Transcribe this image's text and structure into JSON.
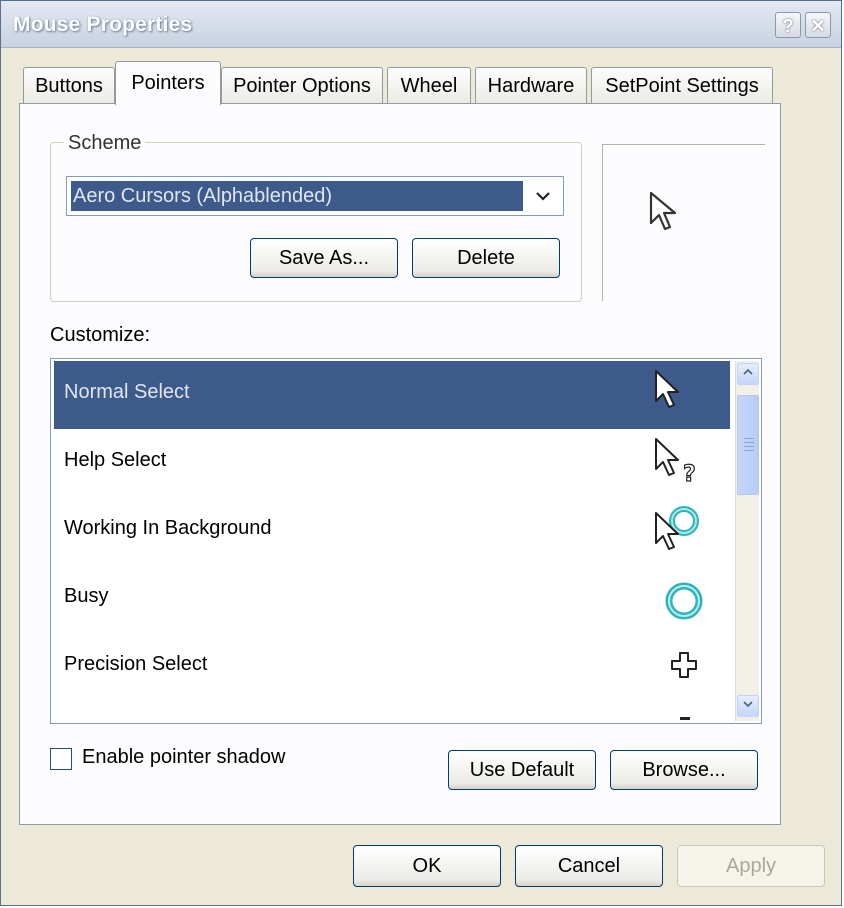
{
  "window": {
    "title": "Mouse Properties",
    "help_glyph": "?",
    "close_glyph": "✕"
  },
  "tabs": [
    "Buttons",
    "Pointers",
    "Pointer Options",
    "Wheel",
    "Hardware",
    "SetPoint Settings"
  ],
  "active_tab": "Pointers",
  "scheme": {
    "label": "Scheme",
    "selected": "Aero Cursors (Alphablended)",
    "dropdown_glyph": "⌄",
    "save_as": "Save As...",
    "delete": "Delete"
  },
  "customize": {
    "label": "Customize:",
    "items": [
      {
        "label": "Normal Select",
        "icon": "arrow-cursor-icon",
        "selected": true
      },
      {
        "label": "Help Select",
        "icon": "help-cursor-icon",
        "selected": false
      },
      {
        "label": "Working In Background",
        "icon": "working-cursor-icon",
        "selected": false
      },
      {
        "label": "Busy",
        "icon": "busy-ring-icon",
        "selected": false
      },
      {
        "label": "Precision Select",
        "icon": "crosshair-cursor-icon",
        "selected": false
      }
    ]
  },
  "pointer_shadow": {
    "label": "Enable pointer shadow",
    "checked": false
  },
  "buttons": {
    "use_default": "Use Default",
    "browse": "Browse...",
    "ok": "OK",
    "cancel": "Cancel",
    "apply": "Apply"
  },
  "colors": {
    "selection": "#3d5a8a",
    "accent_ring": "#2fb3b8"
  }
}
